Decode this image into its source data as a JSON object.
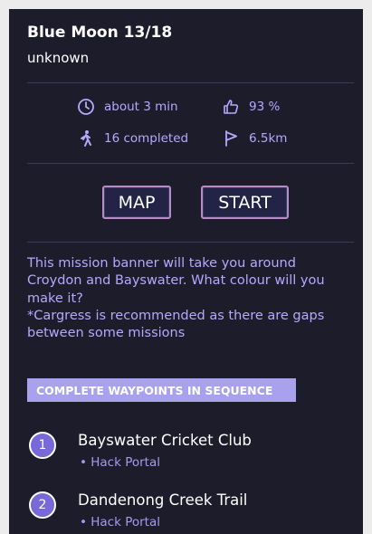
{
  "mission": {
    "title": "Blue Moon 13/18",
    "author": "unknown"
  },
  "stats": {
    "time": "about 3 min",
    "rating": "93 %",
    "completed": "16 completed",
    "distance": "6.5km"
  },
  "buttons": {
    "map": "MAP",
    "start": "START"
  },
  "description": {
    "text": "This mission banner will take you around Croydon and Bayswater. What colour will you make it?",
    "note": "*Cargress is recommended as there are gaps between some missions"
  },
  "sequence_banner": "COMPLETE WAYPOINTS IN SEQUENCE",
  "waypoints": [
    {
      "number": "1",
      "name": "Bayswater Cricket Club",
      "type": "• Hack Portal"
    },
    {
      "number": "2",
      "name": "Dandenong Creek Trail",
      "type": "• Hack Portal"
    }
  ],
  "colors": {
    "background": "#1c1c2b",
    "accent": "#b7a8ff",
    "banner": "#a9a0ee",
    "button_border": "#b78cc6"
  },
  "icons": [
    "clock-icon",
    "thumbs-up-icon",
    "walker-icon",
    "flag-icon"
  ]
}
